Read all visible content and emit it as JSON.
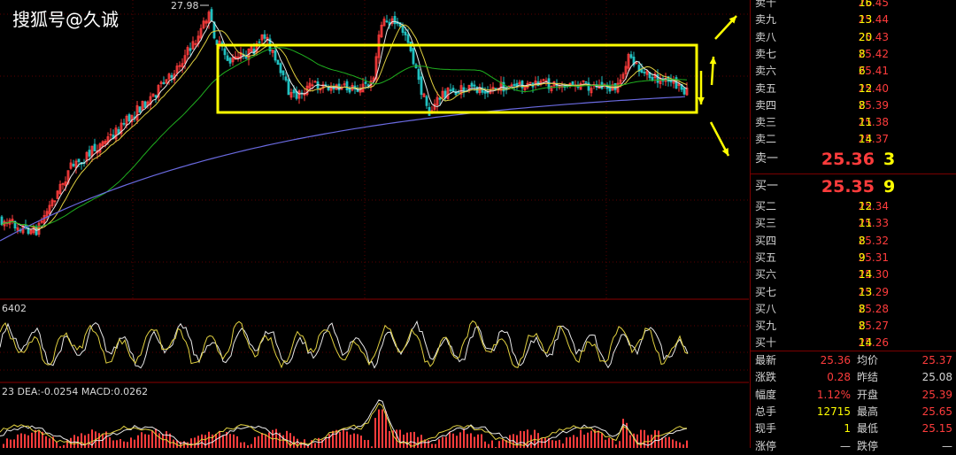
{
  "watermark": "搜狐号@久诚",
  "chart": {
    "peak_label": "27.98",
    "indicator_label": "6402",
    "macd_label": "23 DEA:-0.0254 MACD:0.0262"
  },
  "order_book": {
    "asks": [
      {
        "label": "卖十",
        "price": "25.45",
        "qty": "16"
      },
      {
        "label": "卖九",
        "price": "25.44",
        "qty": "13"
      },
      {
        "label": "卖八",
        "price": "25.43",
        "qty": "20"
      },
      {
        "label": "卖七",
        "price": "25.42",
        "qty": "8"
      },
      {
        "label": "卖六",
        "price": "25.41",
        "qty": "6"
      },
      {
        "label": "卖五",
        "price": "25.40",
        "qty": "12"
      },
      {
        "label": "卖四",
        "price": "25.39",
        "qty": "8"
      },
      {
        "label": "卖三",
        "price": "25.38",
        "qty": "11"
      },
      {
        "label": "卖二",
        "price": "25.37",
        "qty": "14"
      },
      {
        "label": "卖一",
        "price": "25.36",
        "qty": "3"
      }
    ],
    "bids": [
      {
        "label": "买一",
        "price": "25.35",
        "qty": "9"
      },
      {
        "label": "买二",
        "price": "25.34",
        "qty": "12"
      },
      {
        "label": "买三",
        "price": "25.33",
        "qty": "11"
      },
      {
        "label": "买四",
        "price": "25.32",
        "qty": "8"
      },
      {
        "label": "买五",
        "price": "25.31",
        "qty": "9"
      },
      {
        "label": "买六",
        "price": "25.30",
        "qty": "14"
      },
      {
        "label": "买七",
        "price": "25.29",
        "qty": "13"
      },
      {
        "label": "买八",
        "price": "25.28",
        "qty": "8"
      },
      {
        "label": "买九",
        "price": "25.27",
        "qty": "8"
      },
      {
        "label": "买十",
        "price": "25.26",
        "qty": "14"
      }
    ]
  },
  "stats": [
    {
      "k1": "最新",
      "v1": "25.36",
      "c1": "#ff3c3c",
      "k2": "均价",
      "v2": "25.37",
      "c2": "#ff3c3c"
    },
    {
      "k1": "涨跌",
      "v1": "0.28",
      "c1": "#ff3c3c",
      "k2": "昨结",
      "v2": "25.08",
      "c2": "#d4d4d4"
    },
    {
      "k1": "幅度",
      "v1": "1.12%",
      "c1": "#ff3c3c",
      "k2": "开盘",
      "v2": "25.39",
      "c2": "#ff3c3c"
    },
    {
      "k1": "总手",
      "v1": "12715",
      "c1": "#ffff00",
      "k2": "最高",
      "v2": "25.65",
      "c2": "#ff3c3c"
    },
    {
      "k1": "现手",
      "v1": "1",
      "c1": "#ffff00",
      "k2": "最低",
      "v2": "25.15",
      "c2": "#ff3c3c"
    },
    {
      "k1": "涨停",
      "v1": "—",
      "c1": "#d4d4d4",
      "k2": "跌停",
      "v2": "—",
      "c2": "#d4d4d4"
    }
  ],
  "colors": {
    "up": "#ff3c3c",
    "down": "#20c0c0",
    "highlight": "#ffff00",
    "ma_white": "#e8e8e8",
    "ma_yellow": "#e0d040",
    "ma_green": "#1fb01f",
    "ma_blue": "#6a6ae0"
  }
}
